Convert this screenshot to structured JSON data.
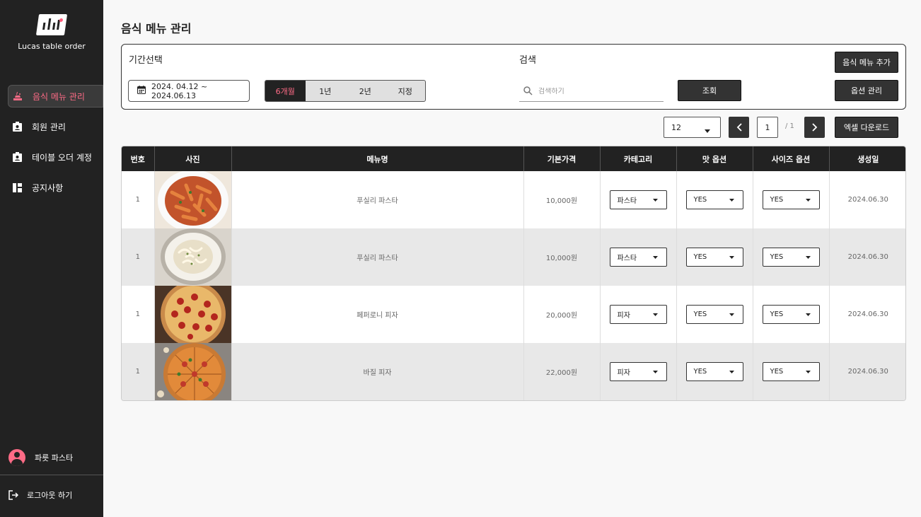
{
  "brand": {
    "name": "Lucas table order"
  },
  "sidebar": {
    "items": [
      {
        "label": "음식 메뉴 관리",
        "icon": "food-menu-icon",
        "active": true
      },
      {
        "label": "회원 관리",
        "icon": "member-badge-icon",
        "active": false
      },
      {
        "label": "테이블 오더 계정",
        "icon": "account-badge-icon",
        "active": false
      },
      {
        "label": "공지사항",
        "icon": "dashboard-icon",
        "active": false
      }
    ],
    "profile_name": "파릇 파스타",
    "logout_label": "로그아웃 하기"
  },
  "page": {
    "title": "음식 메뉴 관리"
  },
  "filters": {
    "period_label": "기간선택",
    "date_range": "2024. 04.12 ~ 2024.06.13",
    "periods": [
      {
        "label": "6개월",
        "selected": true
      },
      {
        "label": "1년",
        "selected": false
      },
      {
        "label": "2년",
        "selected": false
      },
      {
        "label": "지정",
        "selected": false
      }
    ],
    "search_label": "검색",
    "search_placeholder": "검색하기",
    "search_button": "조회",
    "add_menu_button": "음식 메뉴 추가",
    "option_manage_button": "옵션 관리"
  },
  "toolbar": {
    "per_page": "12",
    "current_page": "1",
    "total_pages": "/ 1",
    "excel_button": "엑셀 다운로드"
  },
  "table": {
    "headers": [
      "번호",
      "사진",
      "메뉴명",
      "기본가격",
      "카테고리",
      "맛 옵션",
      "사이즈 옵션",
      "생성일"
    ],
    "rows": [
      {
        "no": "1",
        "photo": "penne-pasta-photo",
        "name": "푸실리 파스타",
        "price": "10,000원",
        "category": "파스타",
        "taste": "YES",
        "size": "YES",
        "date": "2024.06.30"
      },
      {
        "no": "1",
        "photo": "cream-pasta-photo",
        "name": "푸실리 파스타",
        "price": "10,000원",
        "category": "파스타",
        "taste": "YES",
        "size": "YES",
        "date": "2024.06.30"
      },
      {
        "no": "1",
        "photo": "pepperoni-pizza-photo",
        "name": "페퍼로니 피자",
        "price": "20,000원",
        "category": "피자",
        "taste": "YES",
        "size": "YES",
        "date": "2024.06.30"
      },
      {
        "no": "1",
        "photo": "basil-pizza-photo",
        "name": "바질 피자",
        "price": "22,000원",
        "category": "피자",
        "taste": "YES",
        "size": "YES",
        "date": "2024.06.30"
      }
    ]
  },
  "colors": {
    "accent": "#ff6b86",
    "sidebar": "#222222",
    "button": "#333333"
  }
}
